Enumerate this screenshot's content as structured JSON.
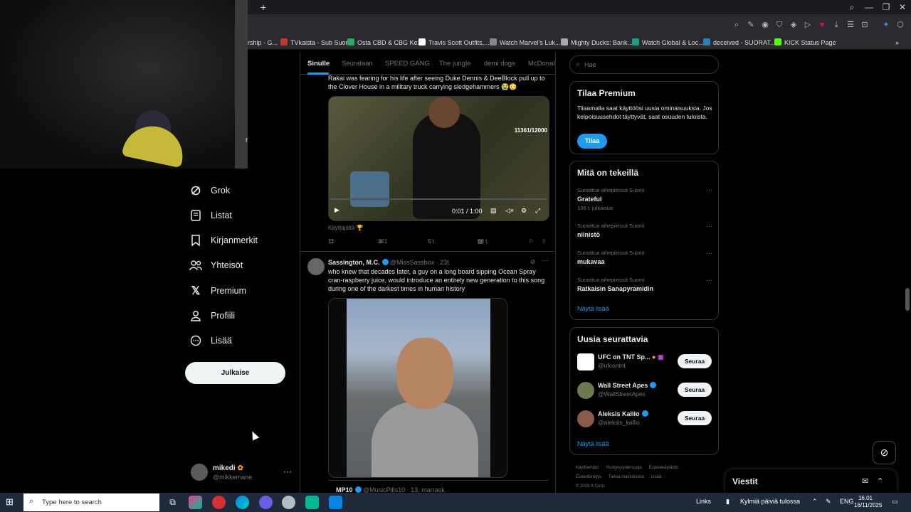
{
  "browser": {
    "bookmarks": [
      {
        "label": "rship - G...",
        "color": "#666"
      },
      {
        "label": "TVkaista - Sub Suora",
        "color": "#c0392b"
      },
      {
        "label": "Osta CBD & CBG Ke...",
        "color": "#27ae60"
      },
      {
        "label": "Travis Scott Outfits,...",
        "color": "#fff"
      },
      {
        "label": "Watch Marvel's Luk...",
        "color": "#888"
      },
      {
        "label": "Mighty Ducks: Bank...",
        "color": "#aaa"
      },
      {
        "label": "Watch Global & Loc...",
        "color": "#16a085"
      },
      {
        "label": "deceived - SUORAT...",
        "color": "#2980b9"
      },
      {
        "label": "KICK Status Page",
        "color": "#53fc18"
      }
    ]
  },
  "webcam": {
    "side_text": "rt"
  },
  "nav": {
    "items": [
      {
        "label": "Grok",
        "icon": "grok-icon"
      },
      {
        "label": "Listat",
        "icon": "lists-icon"
      },
      {
        "label": "Kirjanmerkit",
        "icon": "bookmark-icon"
      },
      {
        "label": "Yhteisöt",
        "icon": "communities-icon"
      },
      {
        "label": "Premium",
        "icon": "x-logo-icon"
      },
      {
        "label": "Profiili",
        "icon": "profile-icon"
      },
      {
        "label": "Lisää",
        "icon": "more-icon"
      }
    ],
    "post_button": "Julkaise",
    "profile": {
      "name": "mikedi",
      "handle": "@mikkemane"
    }
  },
  "feed": {
    "tabs": [
      "Sinulle",
      "Seurataan",
      "SPEED GANG",
      "The jungle",
      "demi dogs",
      "McDonald"
    ],
    "tweet1": {
      "text": "Rakai was fearing for his life after seeing Duke Dennis & DeeBlock pull up to the Clover House in a military truck carrying sledgehammers 😭😳",
      "video_counter": "11361/12000",
      "time": "0:01 / 1:00",
      "attribution": "Käyttäjältä 🏆",
      "replies": "11",
      "reposts": "321",
      "likes": "5 t.",
      "views": "86 t."
    },
    "tweet2": {
      "name": "Sassington, M.C.",
      "handle": "@MissSassbox · 23t",
      "text": "who knew that decades later, a guy on a long board sipping Ocean Spray cran-raspberry juice, would introduce an entirely new generation to this song during one of the darkest times in human history"
    },
    "tweet3": {
      "name": "MP10",
      "handle": "@MusicPills10 · 13. marrask."
    }
  },
  "right": {
    "search_placeholder": "Hae",
    "premium": {
      "title": "Tilaa Premium",
      "desc": "Tilaamalla saat käyttöösi uusia ominaisuuksia. Jos kelpoisuusehdot täyttyvät, saat osuuden tuloista.",
      "button": "Tilaa"
    },
    "trends": {
      "title": "Mitä on tekeillä",
      "items": [
        {
          "context": "Suosittua aihepiirissä Suomi",
          "topic": "Grateful",
          "posts": "136 t. julkaisua"
        },
        {
          "context": "Suosittua aihepiirissä Suomi",
          "topic": "niinistö",
          "posts": ""
        },
        {
          "context": "Suosittua aihepiirissä Suomi",
          "topic": "mukavaa",
          "posts": ""
        },
        {
          "context": "Suosittua aihepiirissä Suomi",
          "topic": "Ratkaisin Sanapyramidin",
          "posts": ""
        }
      ],
      "show_more": "Näytä lisää"
    },
    "who_to_follow": {
      "title": "Uusia seurattavia",
      "items": [
        {
          "name": "UFC on TNT Sp...",
          "handle": "@ufcontnt",
          "button": "Seuraa",
          "color": "#fff"
        },
        {
          "name": "Wall Street Apes",
          "handle": "@WallStreetApes",
          "button": "Seuraa",
          "color": "#6b7a4c"
        },
        {
          "name": "Aleksis Kallio",
          "handle": "@aleksis_kallio",
          "button": "Seuraa",
          "color": "#8a5a4a"
        }
      ],
      "show_more": "Näytä lisää"
    },
    "footer": [
      "Käyttöehdot",
      "Yksityisyydensuoja",
      "Evästekäytäntö",
      "Esteettömyys",
      "Tietoa mainoksista",
      "Lisää ···",
      "© 2025 X Corp."
    ]
  },
  "messages": {
    "title": "Viestit"
  },
  "taskbar": {
    "search_placeholder": "Type here to search",
    "links": "Links",
    "weather": "Kylmiä päiviä tulossa",
    "lang": "ENG",
    "time": "16.01",
    "date": "16/11/2025"
  }
}
